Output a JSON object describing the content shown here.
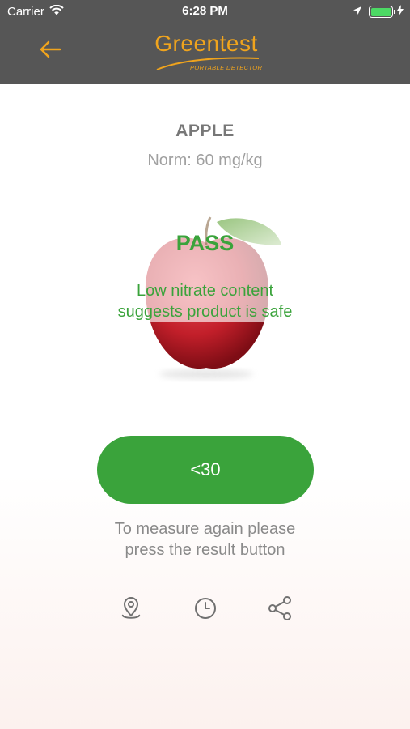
{
  "status_bar": {
    "carrier": "Carrier",
    "time": "6:28 PM",
    "icons": [
      "wifi-icon",
      "location-arrow-icon",
      "battery-icon",
      "charging-bolt-icon"
    ]
  },
  "nav": {
    "back_icon": "arrow-left-icon",
    "brand_name": "Greentest",
    "brand_tagline": "PORTABLE DETECTOR",
    "accent_color": "#f0a41d",
    "bar_color": "#565656"
  },
  "product": {
    "name": "APPLE",
    "norm": "Norm: 60 mg/kg"
  },
  "result": {
    "status": "PASS",
    "description_line1": "Low nitrate content",
    "description_line2": "suggests product is safe",
    "value": "<30",
    "color": "#3aa33b"
  },
  "hint": {
    "line1": "To measure again please",
    "line2": "press the result button"
  },
  "actions": [
    {
      "icon": "location-pin-icon"
    },
    {
      "icon": "clock-icon"
    },
    {
      "icon": "share-icon"
    }
  ]
}
